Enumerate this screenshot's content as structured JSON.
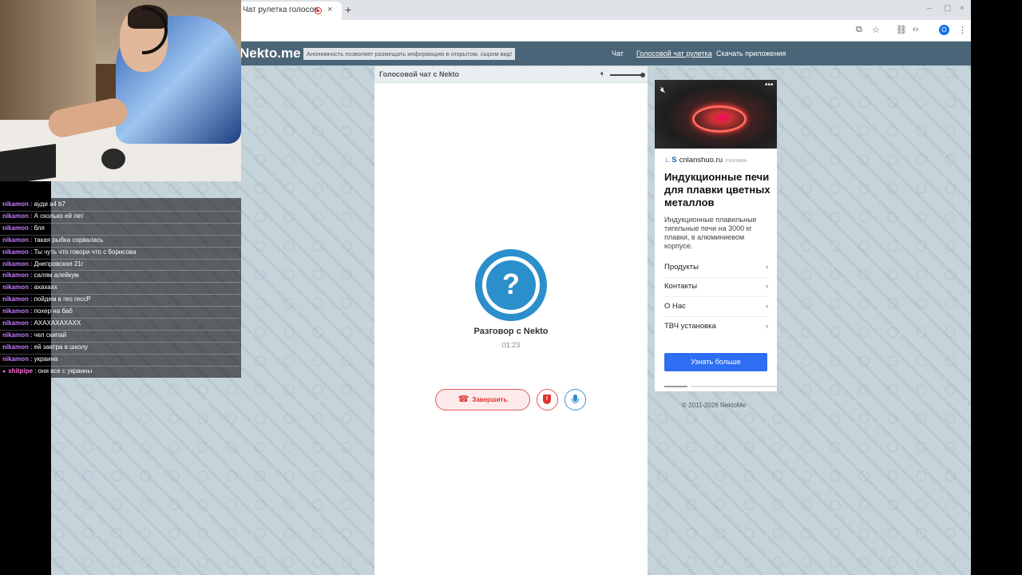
{
  "browser": {
    "tab_title": "Чат рулетка голосов",
    "tab_close": "×",
    "new_tab": "+",
    "window_min": "–",
    "window_max": "▢",
    "window_close": "×",
    "profile_initial": "O"
  },
  "site": {
    "logo": "Nekto.me",
    "anon_note": "Анонимность позволяет размещать информацию в открытом, сыром вид!",
    "nav": [
      "Чат",
      "Голосовой чат рулетка",
      "Скачать приложения"
    ]
  },
  "chat_panel": {
    "title": "Голосовой чат с Nekto",
    "avatar_symbol": "?",
    "talk_title": "Разговор с Nekto",
    "timer": "01:23",
    "end_button": "Завершить",
    "shield_symbol": "!"
  },
  "ad": {
    "source": "cnlanshuo.ru",
    "source_tag": "РЕКЛАМА",
    "title": "Индукционные печи для плавки цветных металлов",
    "description": "Индукционные плавильные тигельные печи на 3000 кг плавки, в алюминиевом корпусе.",
    "links": [
      "Продукты",
      "Контакты",
      "О Нас",
      "ТВЧ установка"
    ],
    "cta": "Узнать больше",
    "progress_active_index": 0
  },
  "copyright": "© 2011-2026 NektoMe",
  "stream_chat": [
    {
      "user": "nikamon",
      "message": " : ауди а4 b7"
    },
    {
      "user": "nikamon",
      "message": " : А сколько ей лет"
    },
    {
      "user": "nikamon",
      "message": " : бля"
    },
    {
      "user": "nikamon",
      "message": " : такая рыбка сорвалась"
    },
    {
      "user": "nikamon",
      "message": " : Ты чуть что говори что с борисова"
    },
    {
      "user": "nikamon",
      "message": " : Днепровская 21г"
    },
    {
      "user": "nikamon",
      "message": " : салям алейкум"
    },
    {
      "user": "nikamon",
      "message": " : ахахахх"
    },
    {
      "user": "nikamon",
      "message": " : пойдем в гео гессР"
    },
    {
      "user": "nikamon",
      "message": " : похер на баб"
    },
    {
      "user": "nikamon",
      "message": " : АХАХАХАХАХХ"
    },
    {
      "user": "nikamon",
      "message": " : чел скипай"
    },
    {
      "user": "nikamon",
      "message": " : ей завтра в школу"
    },
    {
      "user": "nikamon",
      "message": " : украина"
    },
    {
      "user": "shitpipe",
      "message": " : они все с украины"
    }
  ]
}
